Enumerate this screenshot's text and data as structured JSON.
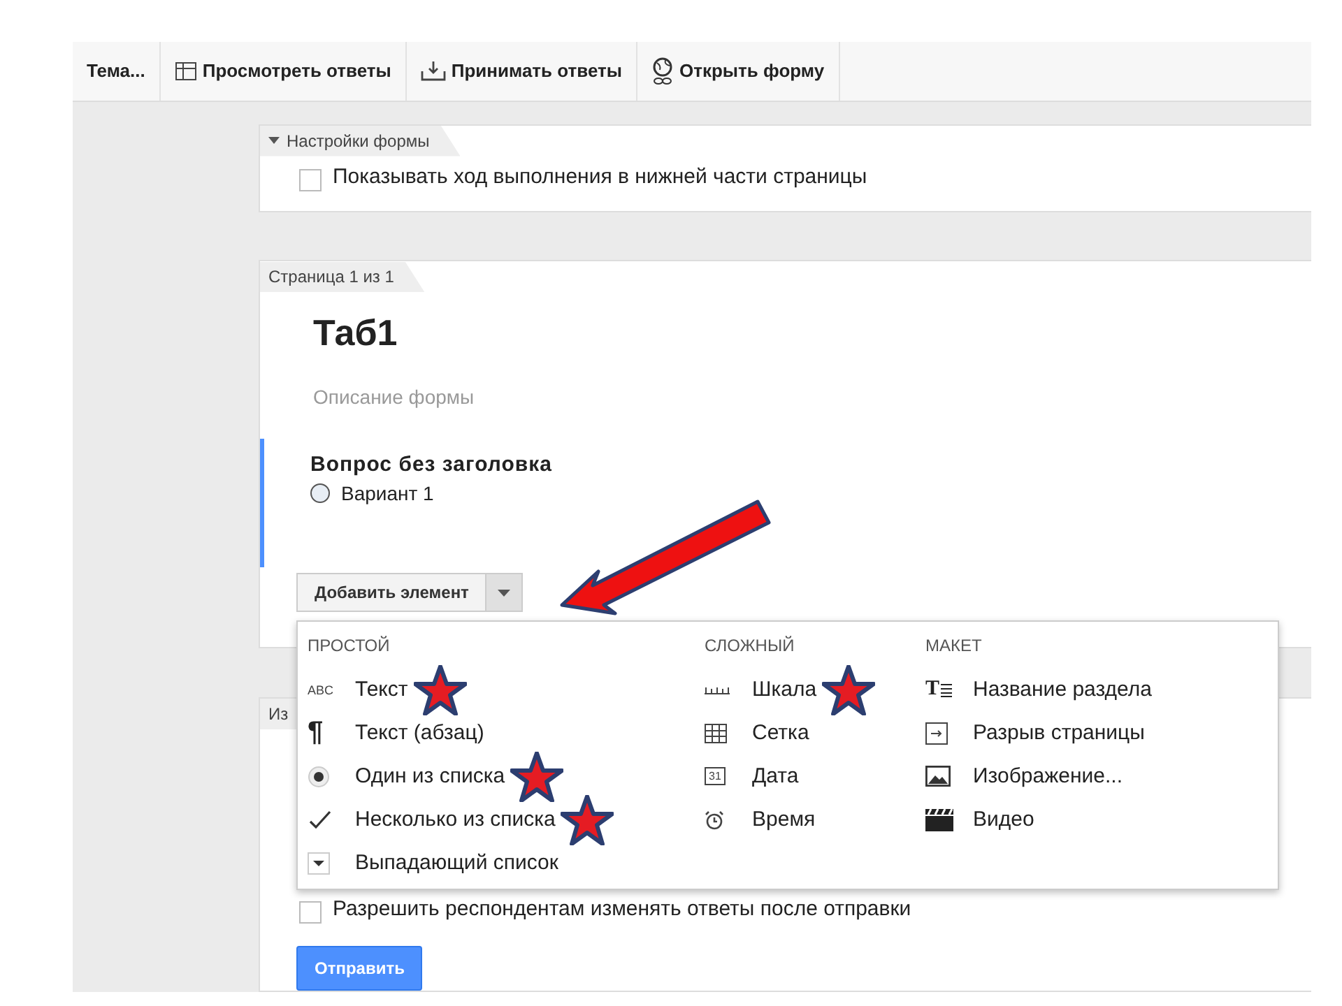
{
  "toolbar": {
    "items": [
      {
        "label": "Тема...",
        "kind": "plain"
      },
      {
        "label": "Просмотреть ответы",
        "kind": "table"
      },
      {
        "label": "Принимать ответы",
        "kind": "download"
      },
      {
        "label": "Открыть форму",
        "kind": "globe"
      }
    ]
  },
  "settings": {
    "header": "Настройки формы",
    "expanded": true,
    "option": {
      "label": "Показывать ход выполнения в нижней части страницы",
      "checked": false
    }
  },
  "page": {
    "header": "Страница 1 из 1",
    "title": "Таб1",
    "description": {
      "placeholder": "Описание формы"
    },
    "question": {
      "title": "Вопрос без заголовка",
      "options": [
        {
          "label": "Вариант 1",
          "selected": false
        }
      ]
    },
    "add_button": {
      "label": "Добавить элемент"
    }
  },
  "menu": {
    "columns": [
      {
        "heading": "ПРОСТОЙ",
        "items": [
          {
            "label": "Текст",
            "kind": "abc",
            "glyph": "ABC",
            "marked": true
          },
          {
            "label": "Текст (абзац)",
            "kind": "paragraph",
            "glyph": "¶",
            "marked": false
          },
          {
            "label": "Один из списка",
            "kind": "radio",
            "marked": true
          },
          {
            "label": "Несколько из списка",
            "kind": "check",
            "marked": true
          },
          {
            "label": "Выпадающий список",
            "kind": "dropdown",
            "marked": false
          }
        ]
      },
      {
        "heading": "СЛОЖНЫЙ",
        "items": [
          {
            "label": "Шкала",
            "kind": "scale",
            "marked": true
          },
          {
            "label": "Сетка",
            "kind": "grid",
            "marked": false
          },
          {
            "label": "Дата",
            "kind": "date",
            "glyph": "31",
            "marked": false
          },
          {
            "label": "Время",
            "kind": "time",
            "marked": false
          }
        ]
      },
      {
        "heading": "МАКЕТ",
        "items": [
          {
            "label": "Название раздела",
            "kind": "title",
            "glyph": "T",
            "marked": false
          },
          {
            "label": "Разрыв страницы",
            "kind": "pagebreak",
            "marked": false
          },
          {
            "label": "Изображение...",
            "kind": "image",
            "marked": false
          },
          {
            "label": "Видео",
            "kind": "video",
            "marked": false
          }
        ]
      }
    ]
  },
  "confirmation": {
    "header": "Из",
    "option": {
      "label": "Разрешить респондентам изменять ответы после отправки",
      "checked": false
    },
    "submit": "Отправить"
  }
}
